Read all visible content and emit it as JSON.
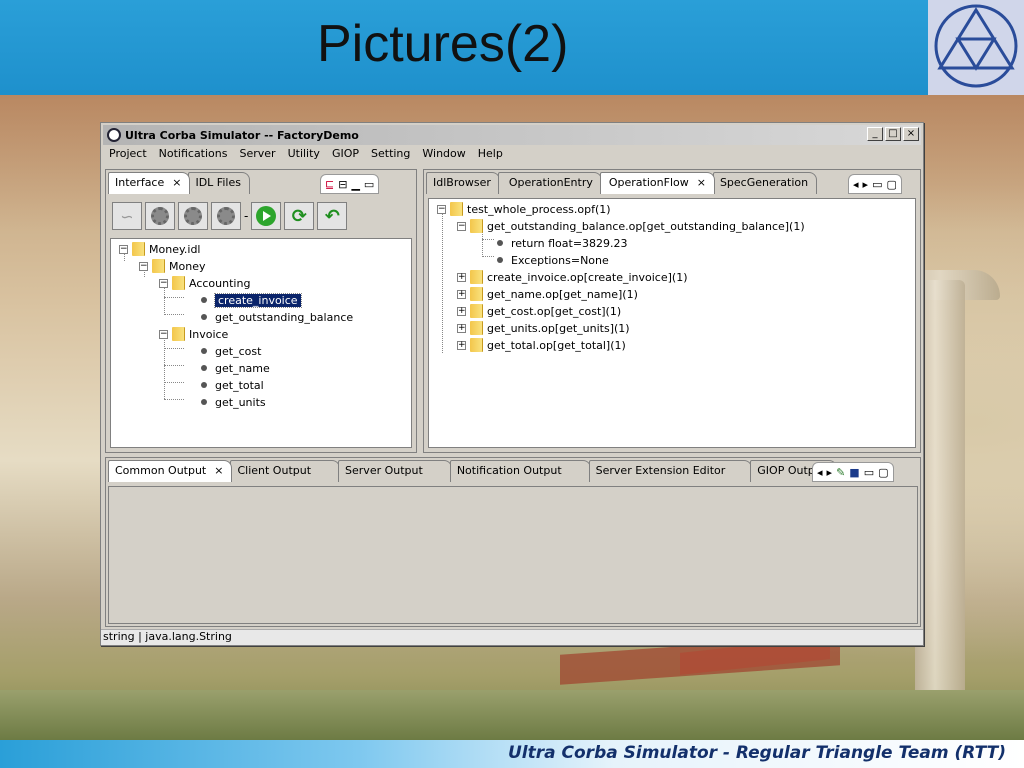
{
  "slide": {
    "title": "Pictures(2)",
    "footer": "Ultra Corba Simulator -   Regular Triangle Team (RTT)"
  },
  "window": {
    "title": "Ultra Corba Simulator  --  FactoryDemo",
    "buttons": [
      "_",
      "□",
      "×"
    ]
  },
  "menubar": [
    "Project",
    "Notifications",
    "Server",
    "Utility",
    "GIOP",
    "Setting",
    "Window",
    "Help"
  ],
  "left_panel": {
    "tabs": [
      {
        "label": "Interface",
        "close": "×",
        "active": true
      },
      {
        "label": "IDL Files",
        "active": false
      }
    ],
    "tree": [
      {
        "label": "Money.idl",
        "type": "folder",
        "expander": "⊟"
      },
      {
        "label": "Money",
        "type": "folder",
        "expander": "⊟"
      },
      {
        "label": "Accounting",
        "type": "folder",
        "expander": "⊟"
      },
      {
        "label": "create_invoice",
        "type": "leaf",
        "selected": true
      },
      {
        "label": "get_outstanding_balance",
        "type": "leaf"
      },
      {
        "label": "Invoice",
        "type": "folder",
        "expander": "⊟"
      },
      {
        "label": "get_cost",
        "type": "leaf"
      },
      {
        "label": "get_name",
        "type": "leaf"
      },
      {
        "label": "get_total",
        "type": "leaf"
      },
      {
        "label": "get_units",
        "type": "leaf"
      }
    ]
  },
  "right_panel": {
    "tabs": [
      {
        "label": "IdlBrowser",
        "active": false
      },
      {
        "label": "OperationEntry",
        "active": false
      },
      {
        "label": "OperationFlow",
        "close": "×",
        "active": true
      },
      {
        "label": "SpecGeneration",
        "active": false
      }
    ],
    "tree": [
      {
        "label": "test_whole_process.opf(1)",
        "type": "folder",
        "expander": "⊟"
      },
      {
        "label": "get_outstanding_balance.op[get_outstanding_balance](1)",
        "type": "folder",
        "expander": "⊟"
      },
      {
        "label": "return float=3829.23",
        "type": "leaf"
      },
      {
        "label": "Exceptions=None",
        "type": "leaf"
      },
      {
        "label": "create_invoice.op[create_invoice](1)",
        "type": "folder",
        "expander": "⊞"
      },
      {
        "label": "get_name.op[get_name](1)",
        "type": "folder",
        "expander": "⊞"
      },
      {
        "label": "get_cost.op[get_cost](1)",
        "type": "folder",
        "expander": "⊞"
      },
      {
        "label": "get_units.op[get_units](1)",
        "type": "folder",
        "expander": "⊞"
      },
      {
        "label": "get_total.op[get_total](1)",
        "type": "folder",
        "expander": "⊞"
      }
    ]
  },
  "bottom_panel": {
    "tabs": [
      {
        "label": "Common Output",
        "close": "×",
        "active": true
      },
      {
        "label": "Client Output",
        "active": false
      },
      {
        "label": "Server Output",
        "active": false
      },
      {
        "label": "Notification Output",
        "active": false
      },
      {
        "label": "Server Extension Editor",
        "active": false
      },
      {
        "label": "GIOP Output",
        "active": false
      }
    ]
  },
  "statusbar": "string  |  java.lang.String"
}
